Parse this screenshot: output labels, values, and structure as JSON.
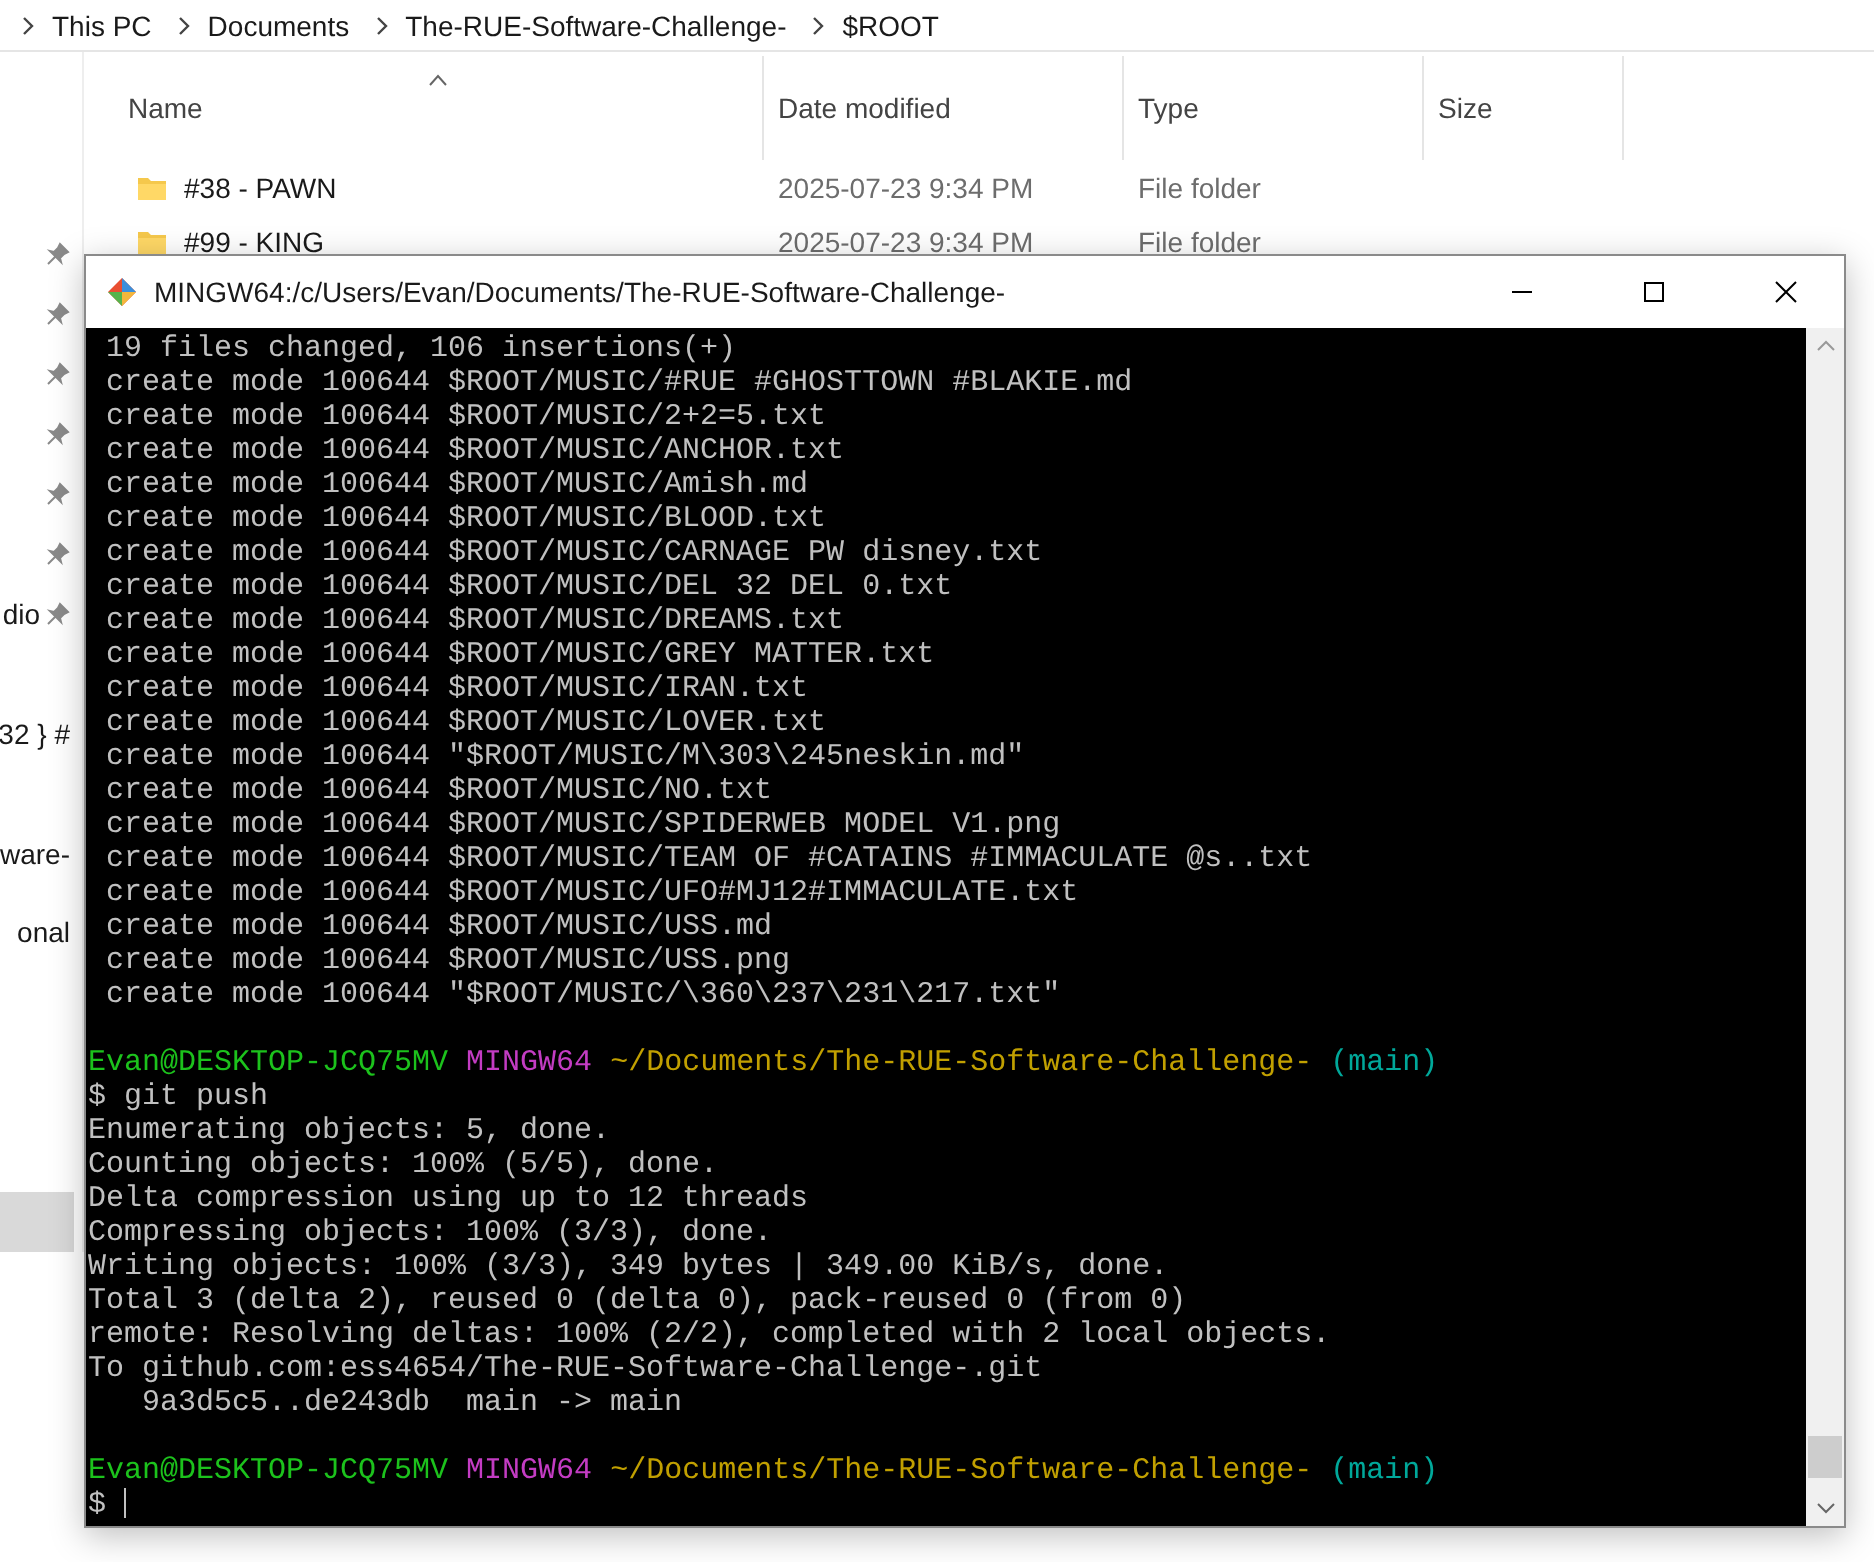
{
  "breadcrumb": [
    {
      "label": "This PC"
    },
    {
      "label": "Documents"
    },
    {
      "label": "The-RUE-Software-Challenge-"
    },
    {
      "label": "$ROOT"
    }
  ],
  "columns": [
    {
      "label": "Name",
      "sorted": true
    },
    {
      "label": "Date modified",
      "sorted": false
    },
    {
      "label": "Type",
      "sorted": false
    },
    {
      "label": "Size",
      "sorted": false
    }
  ],
  "rows": [
    {
      "name": "#38 - PAWN",
      "date": "2025-07-23 9:34 PM",
      "type": "File folder"
    },
    {
      "name": "#99 - KING",
      "date": "2025-07-23 9:34 PM",
      "type": "File folder"
    }
  ],
  "sidebar": {
    "items": [
      {
        "pinned": true,
        "selected": false
      },
      {
        "pinned": true,
        "selected": false
      },
      {
        "pinned": true,
        "selected": false
      },
      {
        "pinned": true,
        "selected": false
      },
      {
        "pinned": true,
        "selected": false
      },
      {
        "pinned": true,
        "selected": false
      },
      {
        "label": "dio",
        "pinned": true,
        "selected": false
      },
      {
        "label": "32 } #",
        "pinned": false,
        "selected": false
      },
      {
        "label": "ware-",
        "pinned": false,
        "selected": false
      },
      {
        "label": "onal",
        "pinned": false,
        "selected": false
      },
      {
        "pinned": false,
        "selected": true
      }
    ]
  },
  "terminal": {
    "title": "MINGW64:/c/Users/Evan/Documents/The-RUE-Software-Challenge-",
    "lines": [
      {
        "kind": "out",
        "text": " 19 files changed, 106 insertions(+)"
      },
      {
        "kind": "out",
        "text": " create mode 100644 $ROOT/MUSIC/#RUE #GHOSTTOWN #BLAKIE.md"
      },
      {
        "kind": "out",
        "text": " create mode 100644 $ROOT/MUSIC/2+2=5.txt"
      },
      {
        "kind": "out",
        "text": " create mode 100644 $ROOT/MUSIC/ANCHOR.txt"
      },
      {
        "kind": "out",
        "text": " create mode 100644 $ROOT/MUSIC/Amish.md"
      },
      {
        "kind": "out",
        "text": " create mode 100644 $ROOT/MUSIC/BLOOD.txt"
      },
      {
        "kind": "out",
        "text": " create mode 100644 $ROOT/MUSIC/CARNAGE PW disney.txt"
      },
      {
        "kind": "out",
        "text": " create mode 100644 $ROOT/MUSIC/DEL 32 DEL 0.txt"
      },
      {
        "kind": "out",
        "text": " create mode 100644 $ROOT/MUSIC/DREAMS.txt"
      },
      {
        "kind": "out",
        "text": " create mode 100644 $ROOT/MUSIC/GREY MATTER.txt"
      },
      {
        "kind": "out",
        "text": " create mode 100644 $ROOT/MUSIC/IRAN.txt"
      },
      {
        "kind": "out",
        "text": " create mode 100644 $ROOT/MUSIC/LOVER.txt"
      },
      {
        "kind": "out",
        "text": " create mode 100644 \"$ROOT/MUSIC/M\\303\\245neskin.md\""
      },
      {
        "kind": "out",
        "text": " create mode 100644 $ROOT/MUSIC/NO.txt"
      },
      {
        "kind": "out",
        "text": " create mode 100644 $ROOT/MUSIC/SPIDERWEB MODEL V1.png"
      },
      {
        "kind": "out",
        "text": " create mode 100644 $ROOT/MUSIC/TEAM OF #CATAINS #IMMACULATE @s..txt"
      },
      {
        "kind": "out",
        "text": " create mode 100644 $ROOT/MUSIC/UFO#MJ12#IMMACULATE.txt"
      },
      {
        "kind": "out",
        "text": " create mode 100644 $ROOT/MUSIC/USS.md"
      },
      {
        "kind": "out",
        "text": " create mode 100644 $ROOT/MUSIC/USS.png"
      },
      {
        "kind": "out",
        "text": " create mode 100644 \"$ROOT/MUSIC/\\360\\237\\231\\217.txt\""
      },
      {
        "kind": "blank"
      },
      {
        "kind": "prompt",
        "user": "Evan@DESKTOP-JCQ75MV",
        "shell": "MINGW64",
        "path": "~/Documents/The-RUE-Software-Challenge-",
        "branch": "(main)"
      },
      {
        "kind": "out",
        "text": "$ git push"
      },
      {
        "kind": "out",
        "text": "Enumerating objects: 5, done."
      },
      {
        "kind": "out",
        "text": "Counting objects: 100% (5/5), done."
      },
      {
        "kind": "out",
        "text": "Delta compression using up to 12 threads"
      },
      {
        "kind": "out",
        "text": "Compressing objects: 100% (3/3), done."
      },
      {
        "kind": "out",
        "text": "Writing objects: 100% (3/3), 349 bytes | 349.00 KiB/s, done."
      },
      {
        "kind": "out",
        "text": "Total 3 (delta 2), reused 0 (delta 0), pack-reused 0 (from 0)"
      },
      {
        "kind": "out",
        "text": "remote: Resolving deltas: 100% (2/2), completed with 2 local objects."
      },
      {
        "kind": "out",
        "text": "To github.com:ess4654/The-RUE-Software-Challenge-.git"
      },
      {
        "kind": "out",
        "text": "   9a3d5c5..de243db  main -> main"
      },
      {
        "kind": "blank"
      },
      {
        "kind": "prompt",
        "user": "Evan@DESKTOP-JCQ75MV",
        "shell": "MINGW64",
        "path": "~/Documents/The-RUE-Software-Challenge-",
        "branch": "(main)"
      },
      {
        "kind": "input",
        "text": "$"
      }
    ]
  }
}
